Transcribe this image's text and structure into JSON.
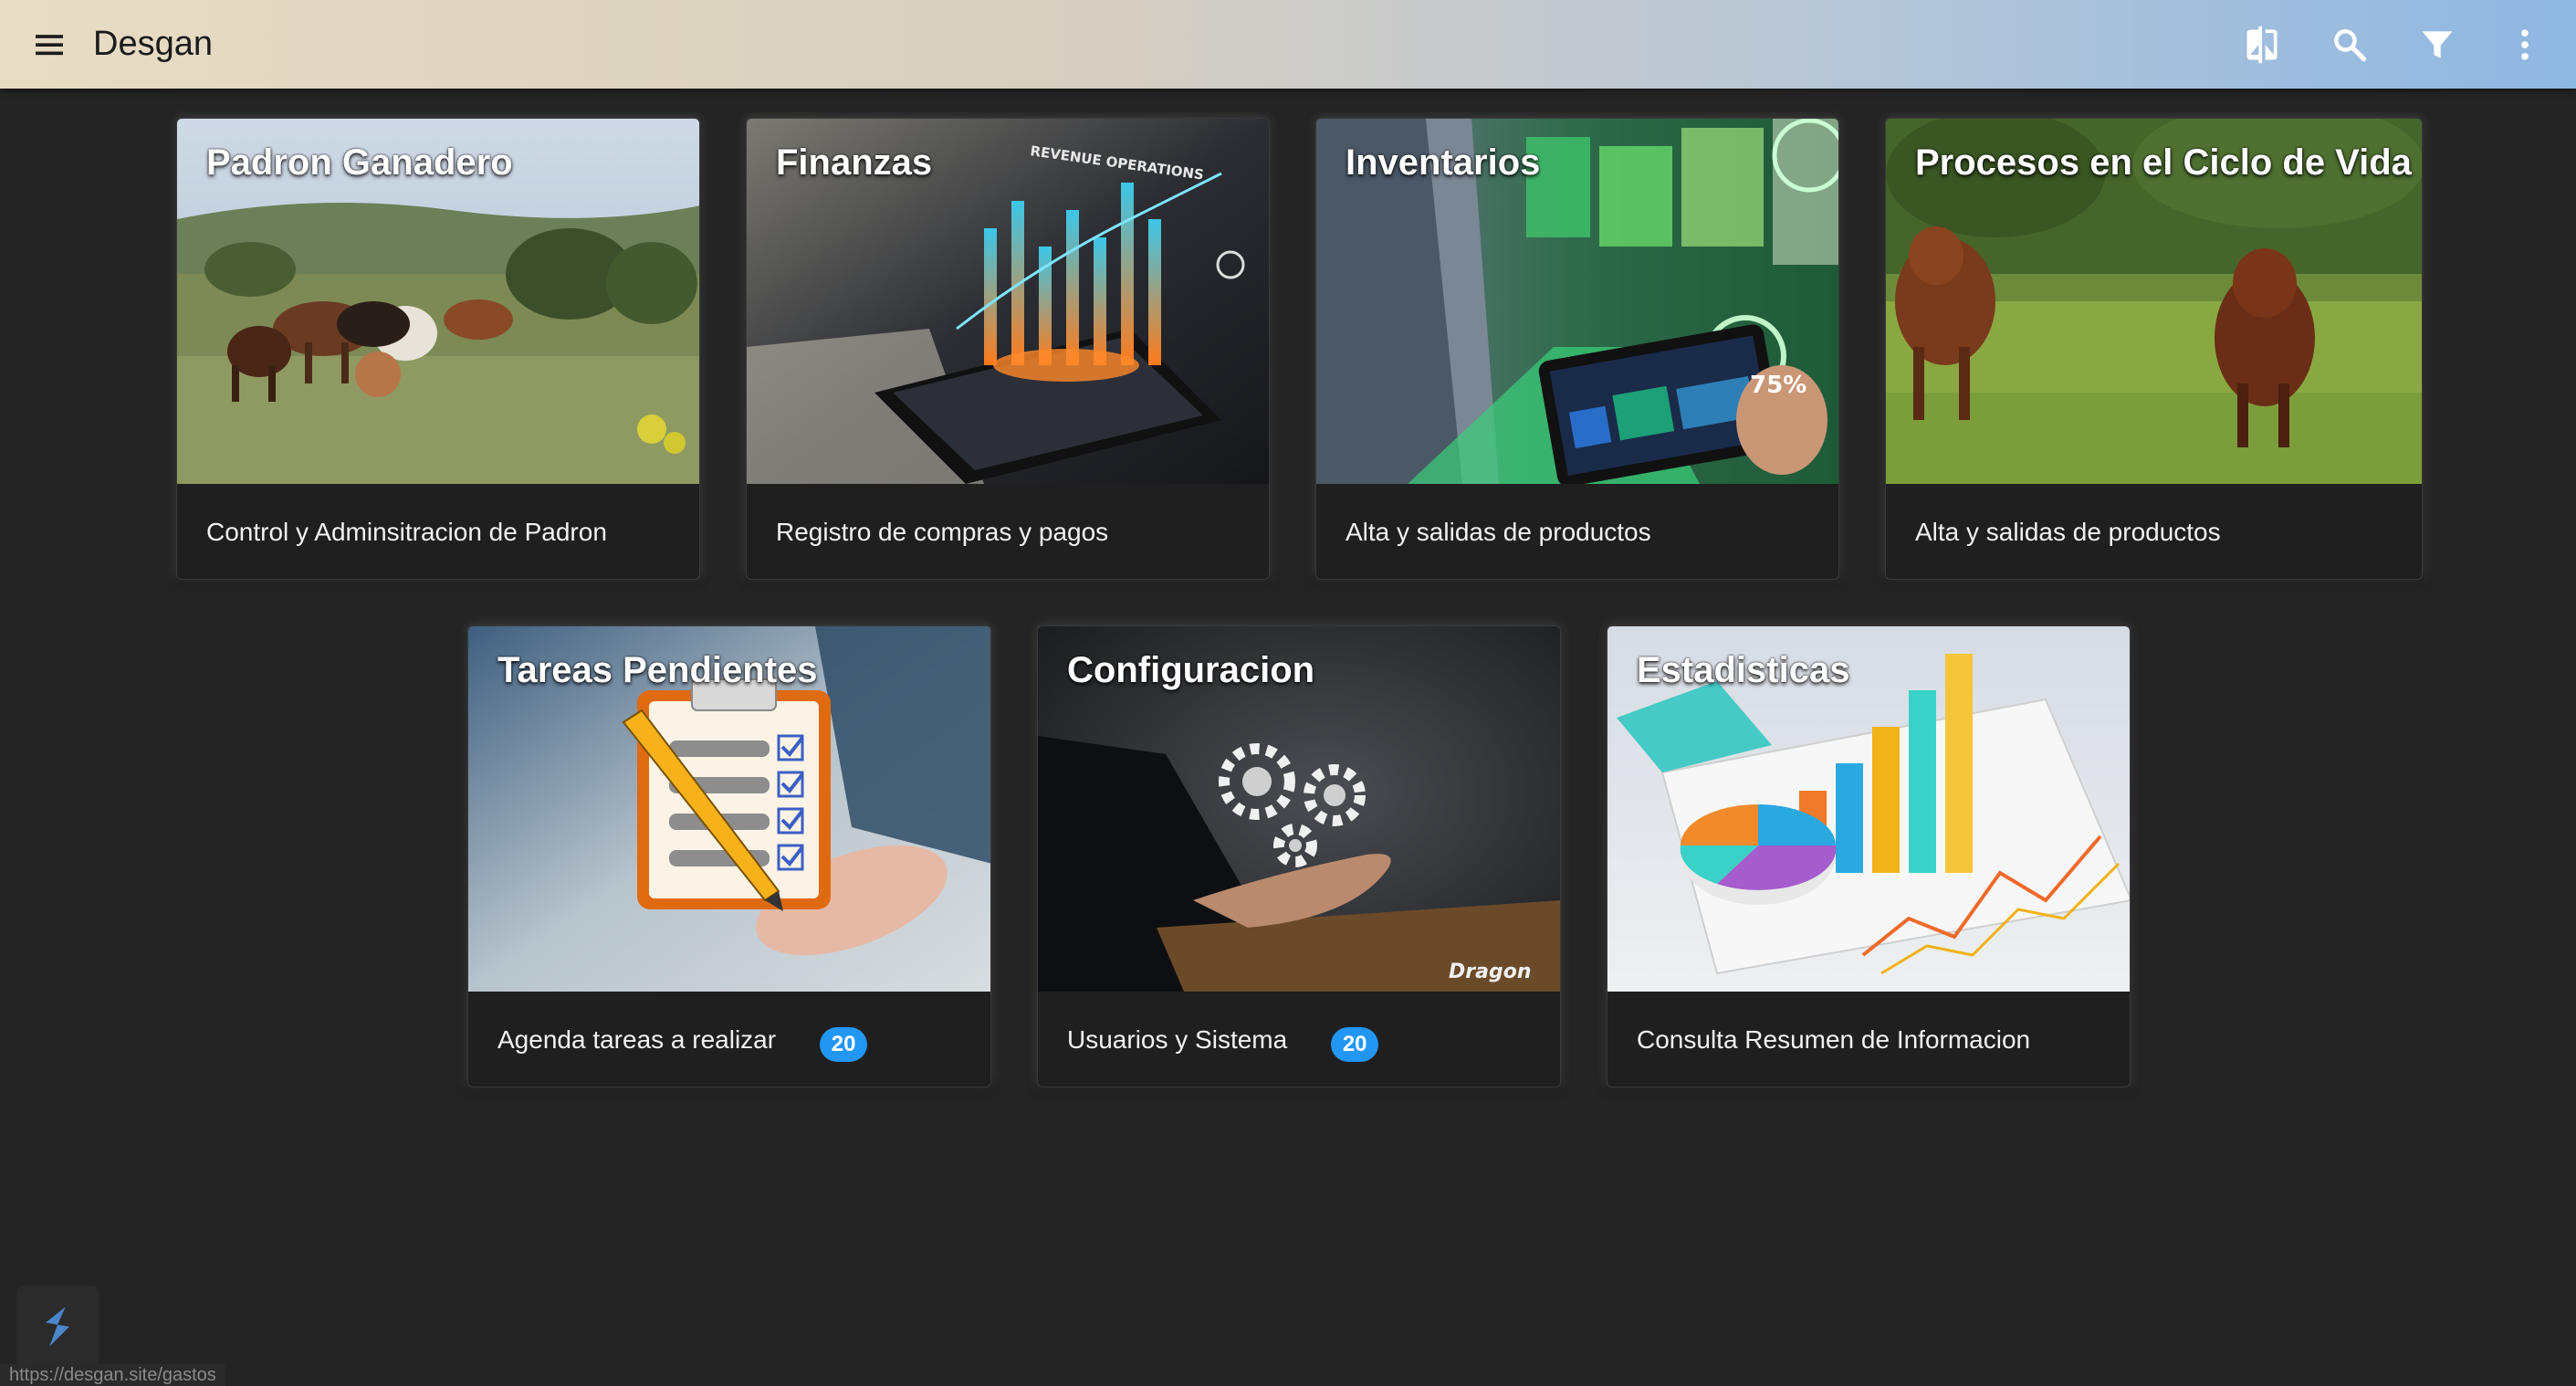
{
  "app": {
    "title": "Desgan",
    "toolbar_icons": [
      "menu-icon",
      "compare-icon",
      "search-icon",
      "filter-icon",
      "more-vert-icon"
    ]
  },
  "colors": {
    "badge": "#2196f3",
    "background": "#242424",
    "card": "#1f1f1f"
  },
  "cards": [
    {
      "title": "Padron Ganadero",
      "subtitle": "Control y Adminsitracion de Padron"
    },
    {
      "title": "Finanzas",
      "subtitle": "Registro de compras y pagos"
    },
    {
      "title": "Inventarios",
      "subtitle": "Alta y salidas de productos"
    },
    {
      "title": "Procesos en el Ciclo de Vida",
      "subtitle": "Alta y salidas de productos"
    },
    {
      "title": "Tareas Pendientes",
      "subtitle": "Agenda tareas a realizar",
      "badge": "20"
    },
    {
      "title": "Configuracion",
      "subtitle": "Usuarios y Sistema",
      "badge": "20"
    },
    {
      "title": "Estadisticas",
      "subtitle": "Consulta Resumen de Informacion"
    }
  ],
  "image_text": {
    "finanzas_banner": "REVENUE OPERATIONS",
    "inventarios_percent": "75%",
    "config_watermark": "Dragon"
  },
  "status_bar": {
    "url": "https://desgan.site/gastos"
  }
}
